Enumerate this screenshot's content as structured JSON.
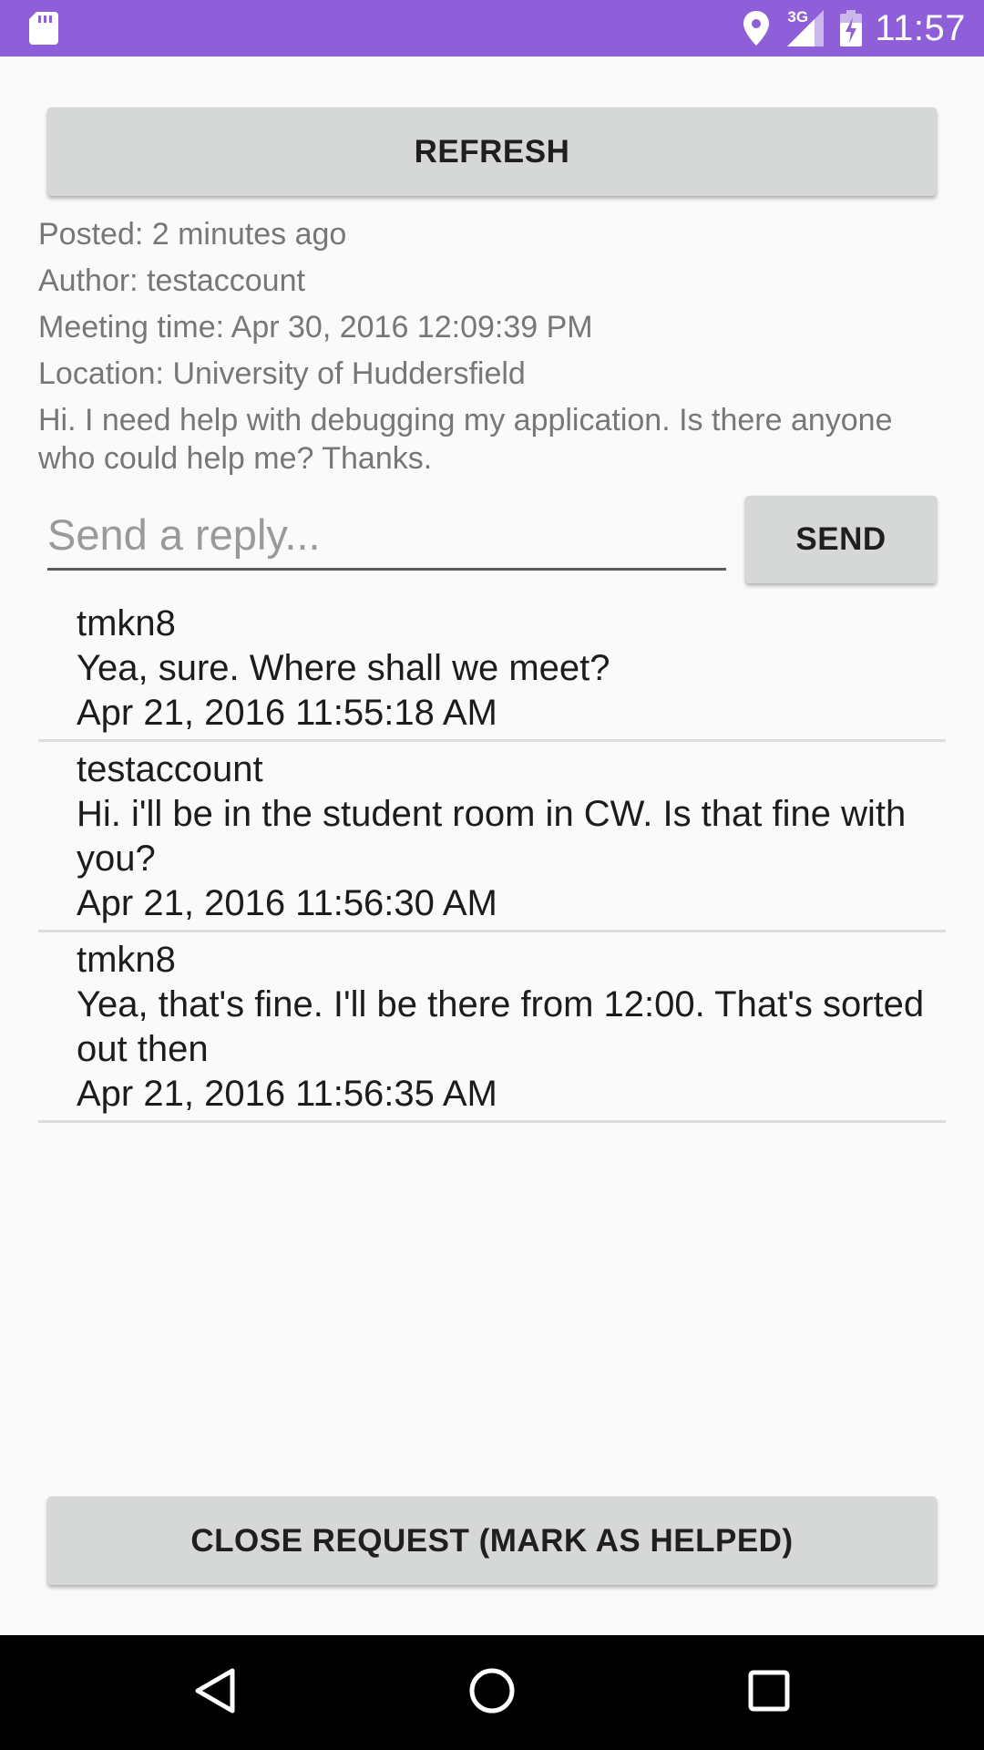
{
  "status_bar": {
    "time": "11:57",
    "network": "3G",
    "icons": [
      "sd-card-icon",
      "location-icon",
      "signal-icon",
      "battery-charging-icon"
    ],
    "color": "#8e5fd8"
  },
  "actions": {
    "refresh_label": "REFRESH",
    "send_label": "SEND",
    "close_label": "CLOSE REQUEST (MARK AS HELPED)"
  },
  "post": {
    "posted": "Posted: 2 minutes ago",
    "author": "Author: testaccount",
    "meeting_time": "Meeting time: Apr 30, 2016 12:09:39 PM",
    "location": "Location: University of Huddersfield",
    "description": "Hi. I need help with debugging my application. Is there anyone who could help me? Thanks."
  },
  "reply_box": {
    "placeholder": "Send a reply...",
    "value": ""
  },
  "replies": [
    {
      "author": "tmkn8",
      "message": "Yea, sure. Where shall we meet?",
      "timestamp": "Apr 21, 2016 11:55:18 AM"
    },
    {
      "author": "testaccount",
      "message": "Hi. i'll be in the student room in CW.  Is that fine with you?",
      "timestamp": "Apr 21, 2016 11:56:30 AM"
    },
    {
      "author": "tmkn8",
      "message": "Yea, that's fine. I'll be there from 12:00. That's sorted out then",
      "timestamp": "Apr 21, 2016 11:56:35 AM"
    }
  ],
  "nav_bar": {
    "icons": [
      "back-icon",
      "home-icon",
      "recents-icon"
    ]
  }
}
